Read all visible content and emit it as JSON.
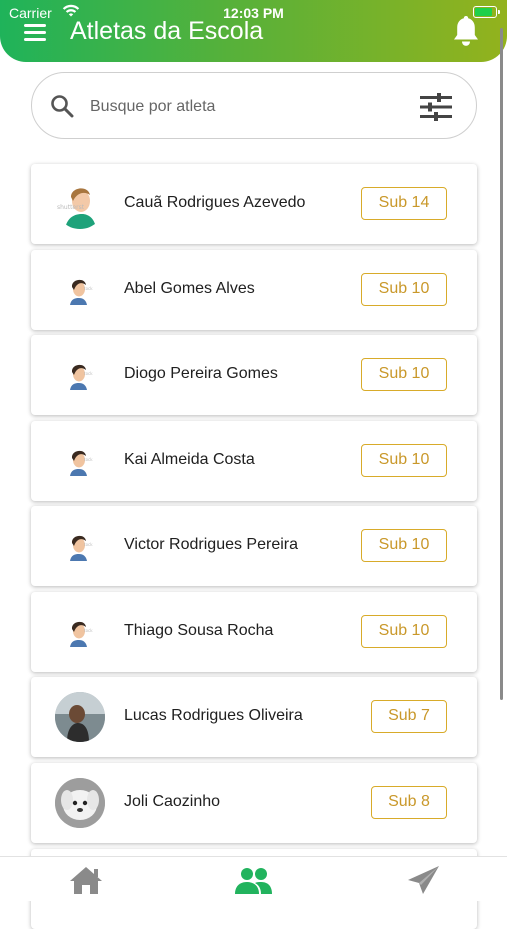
{
  "status_bar": {
    "carrier": "Carrier",
    "time": "12:03 PM"
  },
  "header": {
    "title": "Atletas da Escola"
  },
  "search": {
    "placeholder": "Busque por atleta",
    "value": ""
  },
  "athletes": [
    {
      "name": "Cauã Rodrigues Azevedo",
      "category": "Sub 14",
      "avatar": "illustration-avatar"
    },
    {
      "name": "Abel Gomes Alves",
      "category": "Sub 10",
      "avatar": "illustration-avatar"
    },
    {
      "name": "Diogo Pereira Gomes",
      "category": "Sub 10",
      "avatar": "illustration-avatar"
    },
    {
      "name": "Kai Almeida Costa",
      "category": "Sub 10",
      "avatar": "illustration-avatar"
    },
    {
      "name": "Victor Rodrigues Pereira",
      "category": "Sub 10",
      "avatar": "illustration-avatar"
    },
    {
      "name": "Thiago Sousa Rocha",
      "category": "Sub 10",
      "avatar": "illustration-avatar"
    },
    {
      "name": "Lucas Rodrigues Oliveira",
      "category": "Sub 7",
      "avatar": "photo-avatar"
    },
    {
      "name": "Joli Caozinho",
      "category": "Sub 8",
      "avatar": "dog-photo-avatar"
    }
  ],
  "bottom_nav": {
    "items": [
      {
        "icon": "home-icon",
        "active": false
      },
      {
        "icon": "users-icon",
        "active": true
      },
      {
        "icon": "send-icon",
        "active": false
      }
    ]
  },
  "colors": {
    "header_gradient_start": "#1fb35a",
    "header_gradient_end": "#93b21d",
    "badge_gold": "#d8ab2a",
    "nav_active": "#22b35e",
    "nav_inactive": "#8a8a8a"
  }
}
